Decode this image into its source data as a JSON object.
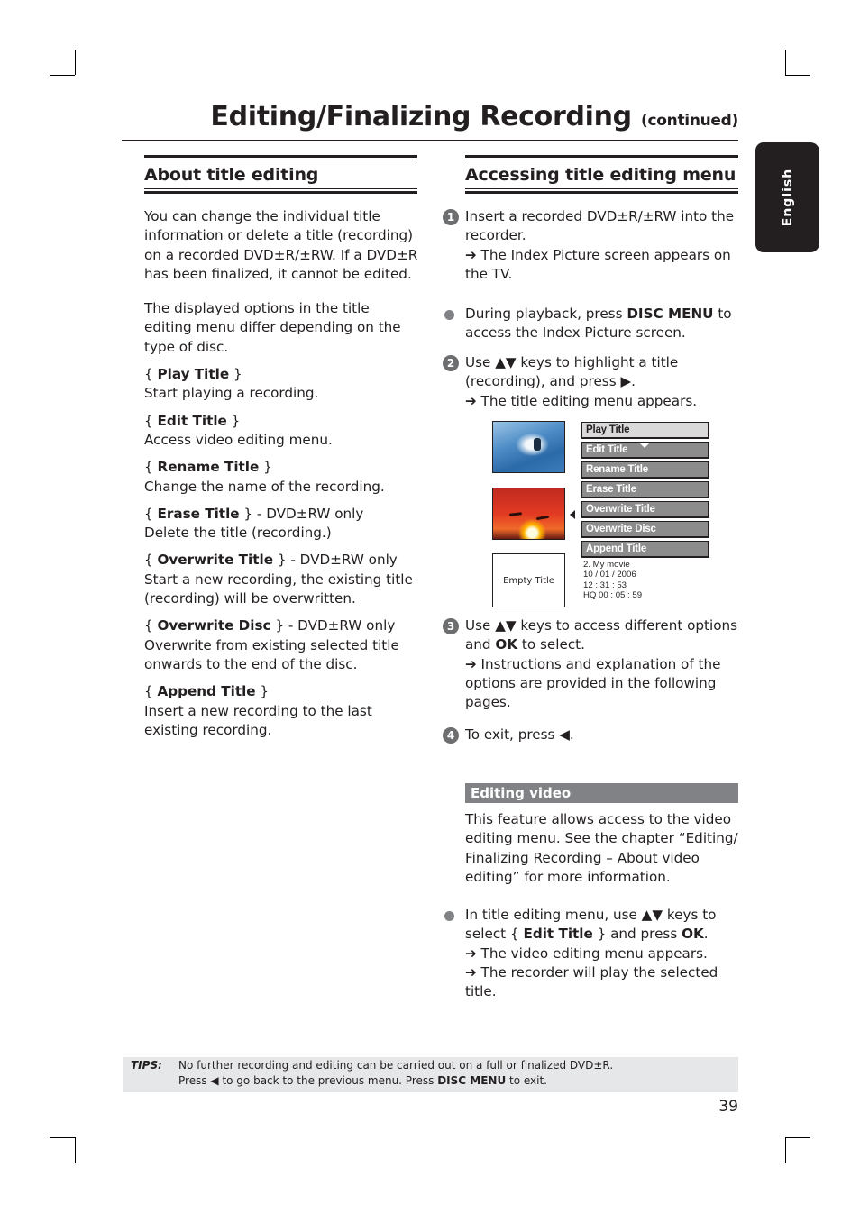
{
  "header": {
    "title": "Editing/Finalizing Recording",
    "continued": "(continued)",
    "language_tab": "English"
  },
  "left_section": {
    "heading": "About title editing",
    "intro": "You can change the individual title information or delete a title (recording) on a recorded DVD±R/±RW. If a DVD±R has been finalized, it cannot be edited.",
    "intro2": "The displayed options in the title editing menu differ depending on the type of disc.",
    "options": [
      {
        "name": "Play Title",
        "suffix": "",
        "desc": "Start playing a recording."
      },
      {
        "name": "Edit Title",
        "suffix": "",
        "desc": "Access video editing menu."
      },
      {
        "name": "Rename Title",
        "suffix": "",
        "desc": "Change the name of the recording."
      },
      {
        "name": "Erase Title",
        "suffix": " - DVD±RW only",
        "desc": "Delete the title (recording.)"
      },
      {
        "name": "Overwrite Title",
        "suffix": " - DVD±RW only",
        "desc": "Start a new recording, the existing title (recording) will be overwritten."
      },
      {
        "name": "Overwrite Disc",
        "suffix": " - DVD±RW only",
        "desc": "Overwrite from existing selected title onwards to the end of the disc."
      },
      {
        "name": "Append Title",
        "suffix": "",
        "desc": "Insert a new recording to the last existing recording."
      }
    ]
  },
  "right_section": {
    "heading": "Accessing title editing menu",
    "step1": {
      "num": "1",
      "text": "Insert a recorded DVD±R/±RW into the recorder.",
      "result": "➔ The Index Picture screen appears on the TV."
    },
    "bullet1": {
      "pre": "During playback, press ",
      "key": "DISC MENU",
      "post": " to access the Index Picture screen."
    },
    "step2": {
      "num": "2",
      "pre": "Use ▲▼ keys to highlight a title (recording), and press ▶.",
      "result": "➔  The title editing menu appears."
    },
    "screen": {
      "menu_items": [
        "Play Title",
        "Edit Title",
        "Rename Title",
        "Erase Title",
        "Overwrite Title",
        "Overwrite Disc",
        "Append Title"
      ],
      "selected_index": 0,
      "empty_label": "Empty Title",
      "info": [
        "2. My movie",
        "10 / 01 / 2006",
        "12 : 31 : 53",
        "HQ 00 : 05 : 59"
      ]
    },
    "step3": {
      "num": "3",
      "pre": "Use ▲▼ keys to access different options and ",
      "key": "OK",
      "post": " to select.",
      "result": "➔ Instructions and explanation of the options are provided in the following pages."
    },
    "step4": {
      "num": "4",
      "text": "To exit, press ◀."
    },
    "sub_heading": "Editing video",
    "sub_intro": "This feature allows access to the video editing menu. See the chapter “Editing/ Finalizing Recording – About video editing” for more information.",
    "bullet2": {
      "pre": "In title editing menu, use ▲▼ keys to select { ",
      "key": "Edit Title",
      "mid": " } and press ",
      "key2": "OK",
      "post": ".",
      "result1": "➔ The video editing menu appears.",
      "result2": "➔ The recorder will play the selected title."
    }
  },
  "tips": {
    "label": "TIPS:",
    "line1": "No further recording and editing can be carried out on a full or finalized DVD±R.",
    "line2_pre": "Press ◀ to go back to the previous menu. Press ",
    "line2_key": "DISC MENU",
    "line2_post": " to exit."
  },
  "page_number": "39"
}
